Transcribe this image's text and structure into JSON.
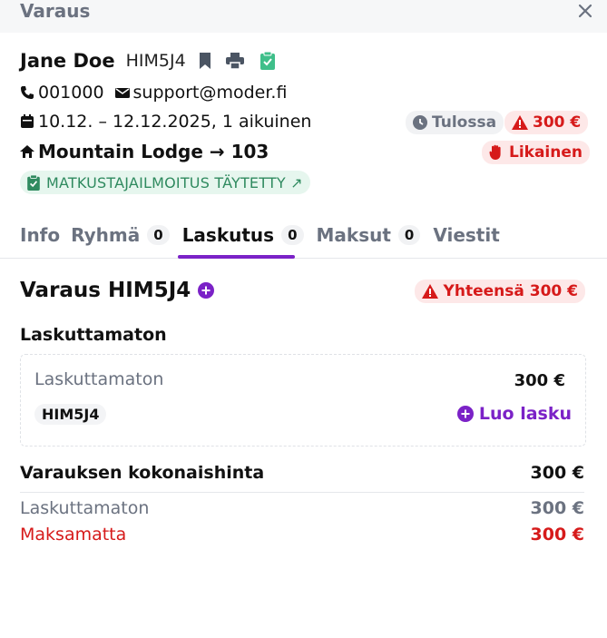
{
  "header": {
    "title": "Varaus"
  },
  "guest": {
    "name": "Jane Doe",
    "code": "HIM5J4"
  },
  "contact": {
    "phone": "001000",
    "email": "support@moder.fi"
  },
  "stay": {
    "dates": "10.12. – 12.12.2025, 1 aikuinen",
    "status": "Tulossa",
    "balance": "300 €"
  },
  "room": {
    "label": "Mountain Lodge → 103",
    "cleaning": "Likainen"
  },
  "registration": {
    "label": "MATKUSTAJAILMOITUS TÄYTETTY ↗"
  },
  "tabs": [
    {
      "label": "Info"
    },
    {
      "label": "Ryhmä",
      "count": "0"
    },
    {
      "label": "Laskutus",
      "count": "0"
    },
    {
      "label": "Maksut",
      "count": "0"
    },
    {
      "label": "Viestit"
    }
  ],
  "billing": {
    "title": "Varaus HIM5J4",
    "total_badge": "Yhteensä 300 €",
    "unbilled_heading": "Laskuttamaton",
    "card": {
      "label": "Laskuttamaton",
      "amount": "300 €",
      "code": "HIM5J4",
      "create": "Luo lasku"
    },
    "summary": [
      {
        "label": "Varauksen kokonaishinta",
        "value": "300 €"
      },
      {
        "label": "Laskuttamaton",
        "value": "300 €"
      },
      {
        "label": "Maksamatta",
        "value": "300 €"
      }
    ]
  },
  "colors": {
    "accent": "#7b22c7",
    "danger": "#d61a1a",
    "success": "#2f8a5f"
  }
}
